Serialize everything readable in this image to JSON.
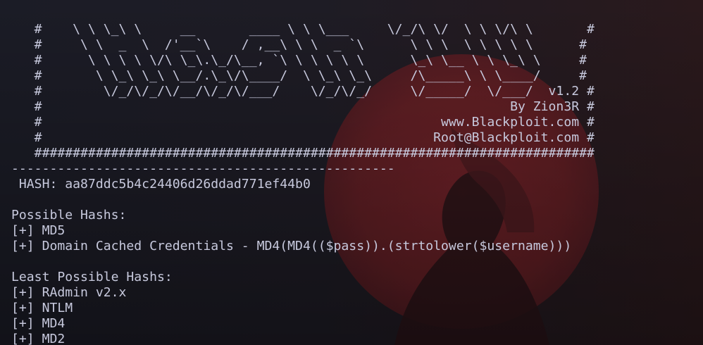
{
  "banner": [
    "   #    \\ \\ \\_\\ \\     __       ____ \\ \\ \\___     \\/_/\\ \\/  \\ \\ \\/\\ \\       #",
    "   #     \\ \\  _  \\  /'__`\\    / ,__\\ \\ \\  _ `\\      \\ \\ \\  \\ \\ \\ \\ \\      #",
    "   #      \\ \\ \\ \\ \\/\\ \\_\\.\\_/\\__, `\\ \\ \\ \\ \\ \\      \\_\\ \\__ \\ \\ \\_\\ \\     #",
    "   #       \\ \\_\\ \\_\\ \\__/.\\_\\/\\____/  \\ \\_\\ \\_\\     /\\_____\\ \\ \\____/     #",
    "   #        \\/_/\\/_/\\/__/\\/_/\\/___/    \\/_/\\/_/     \\/_____/  \\/___/  v1.2 #",
    "   #                                                             By Zion3R #",
    "   #                                                    www.Blackploit.com #",
    "   #                                                   Root@Blackploit.com #",
    "   #########################################################################"
  ],
  "separator": "--------------------------------------------------",
  "hash_line": " HASH: aa87ddc5b4c24406d26ddad771ef44b0",
  "possible_heading": "Possible Hashs:",
  "possible_hashes": [
    "[+] MD5",
    "[+] Domain Cached Credentials - MD4(MD4(($pass)).(strtolower($username)))"
  ],
  "least_heading": "Least Possible Hashs:",
  "least_hashes": [
    "[+] RAdmin v2.x",
    "[+] NTLM",
    "[+] MD4",
    "[+] MD2"
  ],
  "colors": {
    "text": "#c7c9dd",
    "background": "#1b1c26",
    "wallpaper_accent": "#6b1f24"
  }
}
